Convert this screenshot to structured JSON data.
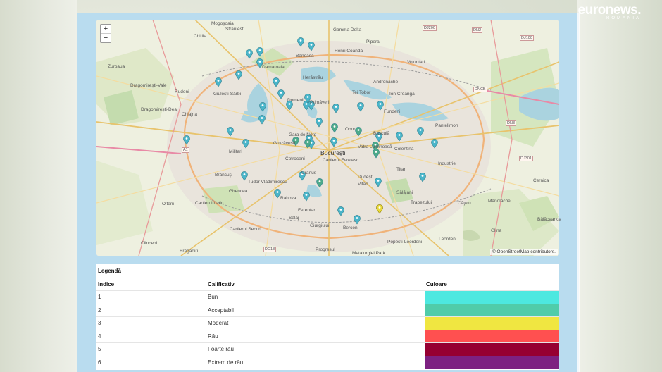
{
  "logo": {
    "main": "euronews.",
    "sub": "ROMANIA"
  },
  "map": {
    "zoom_in": "+",
    "zoom_out": "−",
    "attribution": "© OpenStreetMap contributors.",
    "labels": [
      "Chitila",
      "Straulesti",
      "Voluntari",
      "Gamma Delta",
      "Pipera",
      "Henri Coandă",
      "Băneasa",
      "Vitan",
      "Zurbaua",
      "Dragomirești-Vale",
      "Rudeni",
      "Chiajna",
      "Giulești-Sârbi",
      "Damaroaia",
      "Herăstrău",
      "Andronache",
      "Tei Tobor",
      "Ion Creangă",
      "Dragomirești-Deal",
      "Domenii",
      "Primăverii",
      "Fundeni",
      "Pantelimon",
      "Colentina",
      "Obor",
      "Basculă",
      "Gara de Nord",
      "Grozăvești",
      "București",
      "Vatra Luminoasă",
      "Industriei",
      "Militari",
      "Cotroceni",
      "Cartierul Evreiesc",
      "Dudești",
      "Titan",
      "Brâncuși",
      "Tudor Vladimirescu",
      "Uranus",
      "Ghencea",
      "Rahova",
      "Sălăjani",
      "Trapezului",
      "Cartierul Latin",
      "Ferentari",
      "Olteni",
      "Cernica",
      "Cartierul Securi",
      "Sălaj",
      "Giurgiului",
      "Berceni",
      "Glina",
      "Clinceni",
      "Bragadiru",
      "Progresul",
      "Metalurgiei Park",
      "Popești-Leordeni",
      "Leordeni",
      "Manolache",
      "Bălăceanca",
      "Căţelu",
      "Mogoşoaia"
    ],
    "roads": [
      "DJ200",
      "DN2",
      "DJ100",
      "DNCB",
      "A1",
      "DN3",
      "DJ301",
      "DC18"
    ]
  },
  "legend": {
    "title": "Legendă",
    "headers": {
      "index": "Indice",
      "rating": "Calificativ",
      "color": "Culoare"
    },
    "rows": [
      {
        "index": "1",
        "rating": "Bun",
        "color": "#4de8e0"
      },
      {
        "index": "2",
        "rating": "Acceptabil",
        "color": "#50ccaa"
      },
      {
        "index": "3",
        "rating": "Moderat",
        "color": "#f0e641"
      },
      {
        "index": "4",
        "rating": "Rău",
        "color": "#ff5050"
      },
      {
        "index": "5",
        "rating": "Foarte rău",
        "color": "#960032"
      },
      {
        "index": "6",
        "rating": "Extrem de rău",
        "color": "#7d2181"
      }
    ]
  },
  "markers": {
    "good_color": "#4bb5c9",
    "acceptable_color": "#4daa8a",
    "moderate_color": "#e8d93a"
  }
}
